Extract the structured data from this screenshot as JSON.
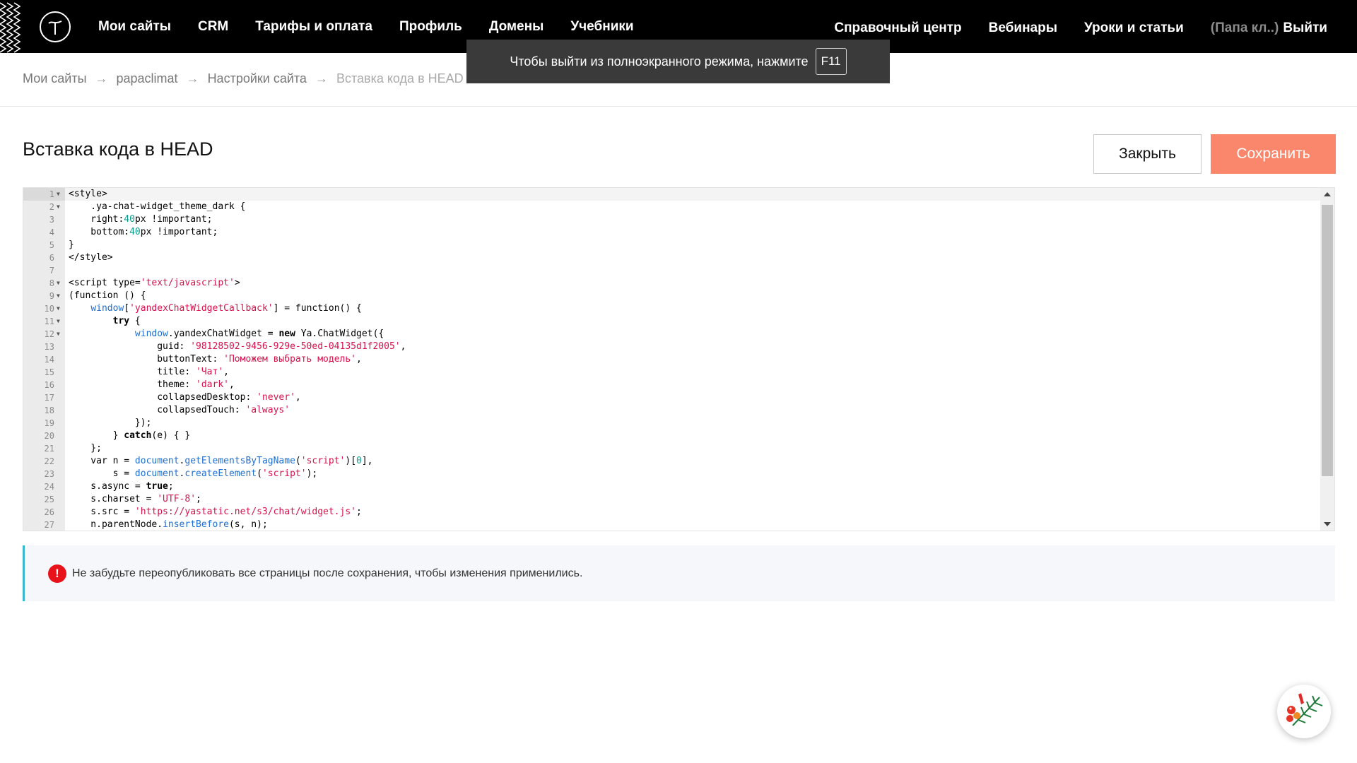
{
  "nav": {
    "left": [
      "Мои сайты",
      "CRM",
      "Тарифы и оплата",
      "Профиль",
      "Домены",
      "Учебники"
    ],
    "right": [
      "Справочный центр",
      "Вебинары",
      "Уроки и статьи"
    ],
    "account": "(Папа кл..)",
    "logout": "Выйти"
  },
  "fullscreen_tip": {
    "text": "Чтобы выйти из полноэкранного режима, нажмите",
    "key": "F11"
  },
  "breadcrumbs": [
    "Мои сайты",
    "papaclimat",
    "Настройки сайта",
    "Вставка кода в HEAD"
  ],
  "breadcrumb_separator": "→",
  "page": {
    "title": "Вставка кода в HEAD",
    "close_label": "Закрыть",
    "save_label": "Сохранить"
  },
  "editor": {
    "fold_glyph": "▼",
    "lines": [
      {
        "n": "1",
        "fold": true,
        "text": "<style>"
      },
      {
        "n": "2",
        "fold": true,
        "text": "    .ya-chat-widget_theme_dark {"
      },
      {
        "n": "3",
        "fold": false,
        "text": "    right:40px !important;"
      },
      {
        "n": "4",
        "fold": false,
        "text": "    bottom:40px !important;"
      },
      {
        "n": "5",
        "fold": false,
        "text": "}"
      },
      {
        "n": "6",
        "fold": false,
        "text": "</style>"
      },
      {
        "n": "7",
        "fold": false,
        "text": ""
      },
      {
        "n": "8",
        "fold": true,
        "text": "<script type='text/javascript'>"
      },
      {
        "n": "9",
        "fold": true,
        "text": "(function () {"
      },
      {
        "n": "10",
        "fold": true,
        "text": "    window['yandexChatWidgetCallback'] = function() {"
      },
      {
        "n": "11",
        "fold": true,
        "text": "        try {"
      },
      {
        "n": "12",
        "fold": true,
        "text": "            window.yandexChatWidget = new Ya.ChatWidget({"
      },
      {
        "n": "13",
        "fold": false,
        "text": "                guid: '98128502-9456-929e-50ed-04135d1f2005',"
      },
      {
        "n": "14",
        "fold": false,
        "text": "                buttonText: 'Поможем выбрать модель',"
      },
      {
        "n": "15",
        "fold": false,
        "text": "                title: 'Чат',"
      },
      {
        "n": "16",
        "fold": false,
        "text": "                theme: 'dark',"
      },
      {
        "n": "17",
        "fold": false,
        "text": "                collapsedDesktop: 'never',"
      },
      {
        "n": "18",
        "fold": false,
        "text": "                collapsedTouch: 'always'"
      },
      {
        "n": "19",
        "fold": false,
        "text": "            });"
      },
      {
        "n": "20",
        "fold": false,
        "text": "        } catch(e) { }"
      },
      {
        "n": "21",
        "fold": false,
        "text": "    };"
      },
      {
        "n": "22",
        "fold": false,
        "text": "    var n = document.getElementsByTagName('script')[0],"
      },
      {
        "n": "23",
        "fold": false,
        "text": "        s = document.createElement('script');"
      },
      {
        "n": "24",
        "fold": false,
        "text": "    s.async = true;"
      },
      {
        "n": "25",
        "fold": false,
        "text": "    s.charset = 'UTF-8';"
      },
      {
        "n": "26",
        "fold": false,
        "text": "    s.src = 'https://yastatic.net/s3/chat/widget.js';"
      },
      {
        "n": "27",
        "fold": false,
        "text": "    n.parentNode.insertBefore(s, n);"
      }
    ]
  },
  "notice": {
    "icon": "!",
    "text": "Не забудьте переопубликовать все страницы после сохранения, чтобы изменения применились."
  },
  "colors": {
    "topbar": "#000000",
    "save_button": "#fa876b",
    "notice_accent": "#38b8cf",
    "warning": "#e8131a",
    "code_string": "#d6124b",
    "code_number": "#0b9b8c",
    "code_builtin": "#1f6fd1"
  }
}
